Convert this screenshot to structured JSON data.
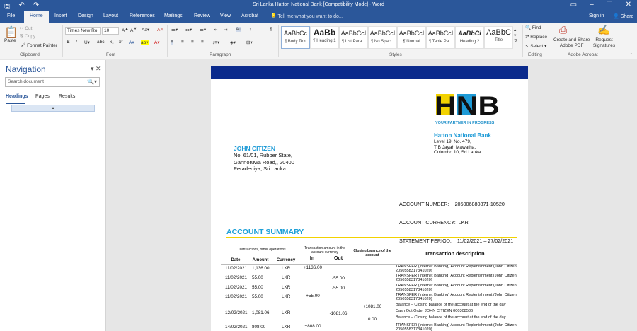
{
  "window": {
    "title": "Sri Lanka Hatton National Bank [Compatibility Mode] - Word",
    "sign_in": "Sign in",
    "share": "Share"
  },
  "tabs": [
    "File",
    "Home",
    "Insert",
    "Design",
    "Layout",
    "References",
    "Mailings",
    "Review",
    "View",
    "Acrobat"
  ],
  "tell_me": "Tell me what you want to do...",
  "ribbon": {
    "clipboard": {
      "label": "Clipboard",
      "paste": "Paste",
      "cut": "Cut",
      "copy": "Copy",
      "format_painter": "Format Painter"
    },
    "font": {
      "label": "Font",
      "family": "Times New Ro",
      "size": "10"
    },
    "paragraph": {
      "label": "Paragraph"
    },
    "styles": {
      "label": "Styles",
      "items": [
        {
          "sample": "AaBbCc",
          "name": "¶ Body Text"
        },
        {
          "sample": "AaBb",
          "name": "¶ Heading 1"
        },
        {
          "sample": "AaBbCcI",
          "name": "¶ List Para..."
        },
        {
          "sample": "AaBbCcI",
          "name": "¶ No Spac..."
        },
        {
          "sample": "AaBbCcI",
          "name": "¶ Normal"
        },
        {
          "sample": "AaBbCcI",
          "name": "¶ Table Pa..."
        },
        {
          "sample": "AaBbCi",
          "name": "Heading 2"
        },
        {
          "sample": "AaBbC",
          "name": "Title"
        }
      ]
    },
    "editing": {
      "label": "Editing",
      "find": "Find",
      "replace": "Replace",
      "select": "Select"
    },
    "acrobat": {
      "label": "Adobe Acrobat",
      "create": "Create and Share\nAdobe PDF",
      "request": "Request\nSignatures"
    }
  },
  "navigation": {
    "title": "Navigation",
    "search_placeholder": "Search document",
    "tabs": [
      "Headings",
      "Pages",
      "Results"
    ]
  },
  "document": {
    "logo_text": "HNB",
    "tagline": "YOUR PARTNER IN PROGRESS",
    "bank_name": "Hatton National Bank",
    "bank_address": [
      "Level 19, No. 479,",
      "T B Jayah Mawatha,",
      "Colombo 10, Sri Lanka"
    ],
    "customer_name": "JOHN CITIZEN",
    "customer_address": [
      "No. 61/01, Rubber State,",
      "Gannoruwa Road,, 20400",
      "Peradeniya, Sri Lanka"
    ],
    "account_number_label": "ACCOUNT NUMBER:",
    "account_number": "205006880871-10520",
    "account_currency_label": "ACCOUNT CURRENCY:",
    "account_currency": "LKR",
    "statement_period_label": "STATEMENT PERIOD:",
    "statement_period": "11/02/2021 – 27/02/2021",
    "summary_title": "ACCOUNT SUMMARY",
    "table_headers": {
      "group1": "Transactions, other operations",
      "group2": "Transaction amount in the account currency",
      "closing": "Closing balance of the account",
      "description": "Transaction description",
      "date": "Date",
      "amount": "Amount",
      "currency": "Currency",
      "in": "In",
      "out": "Out"
    },
    "rows": [
      {
        "date": "11/02/2021",
        "amount": "1,136.00",
        "currency": "LKR",
        "in": "+1136.00",
        "out": "",
        "closing": "",
        "desc": "TRANSFER (Internet Banking) Account Replenishment (John Citizen 2050558317341020)"
      },
      {
        "date": "11/02/2021",
        "amount": "55.00",
        "currency": "LKR",
        "in": "",
        "out": "-55.00",
        "closing": "",
        "desc": "TRANSFER (Internet Banking) Account Replenishment (John Citizen 2050558317341020)"
      },
      {
        "date": "11/02/2021",
        "amount": "55.00",
        "currency": "LKR",
        "in": "",
        "out": "-55.00",
        "closing": "",
        "desc": "TRANSFER (Internet Banking) Account Replenishment (John Citizen 2050558317341020)"
      },
      {
        "date": "11/02/2021",
        "amount": "55.00",
        "currency": "LKR",
        "in": "+55.00",
        "out": "",
        "closing": "",
        "desc": "TRANSFER (Internet Banking) Account Replenishment (John Citizen 2050558317341020)"
      },
      {
        "date": "",
        "amount": "",
        "currency": "",
        "in": "",
        "out": "",
        "closing": "+1081.06",
        "desc": "Balance – Closing balance of the account at the end of the day"
      },
      {
        "date": "12/02/2021",
        "amount": "1,081.06",
        "currency": "LKR",
        "in": "",
        "out": "-1081.06",
        "closing": "",
        "desc": "Cash Out Order JOHN CITIZEN 000308536"
      },
      {
        "date": "",
        "amount": "",
        "currency": "",
        "in": "",
        "out": "",
        "closing": "0.00",
        "desc": "Balance – Closing balance of the account at the end of the day"
      },
      {
        "date": "14/02/2021",
        "amount": "808.00",
        "currency": "LKR",
        "in": "+808.00",
        "out": "",
        "closing": "",
        "desc": "TRANSFER (Internet Banking) Account Replenishment (John Citizen 2050558317341020)"
      }
    ]
  },
  "colors": {
    "word_blue": "#2b579a",
    "band": "#0a2a8c",
    "logo_blue": "#1e9bd7",
    "logo_yellow": "#f2d200"
  }
}
